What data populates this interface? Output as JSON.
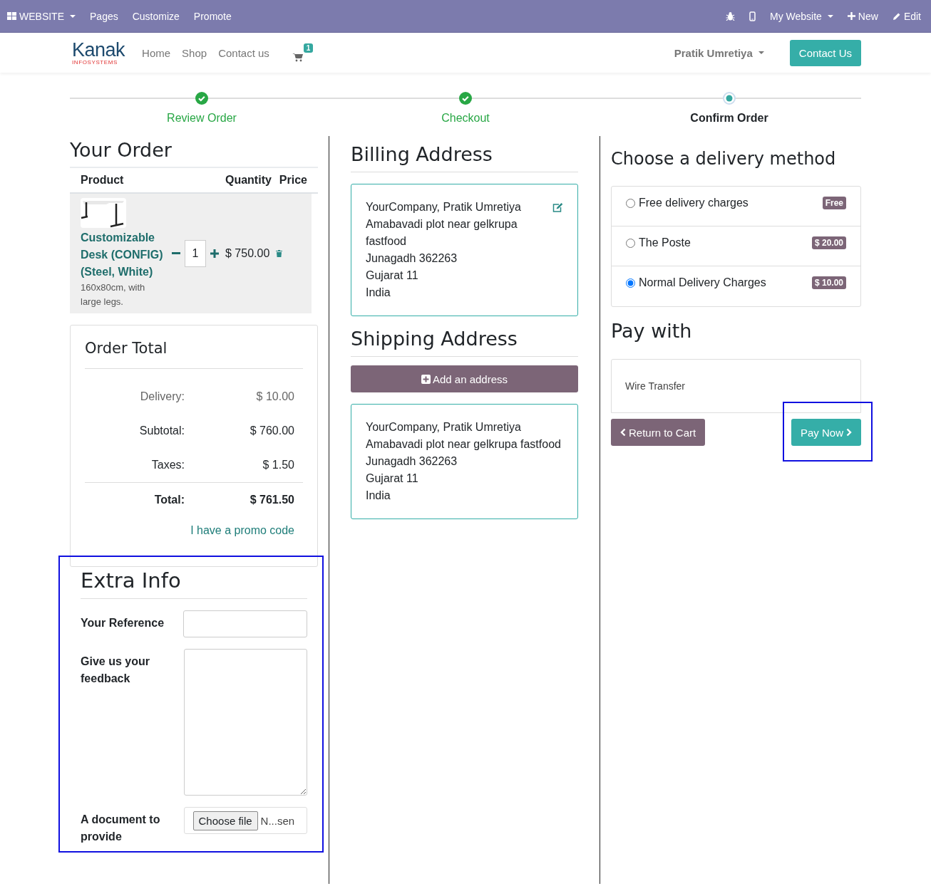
{
  "admin_bar": {
    "app_menu": "WEBSITE",
    "menu": [
      "Pages",
      "Customize",
      "Promote"
    ],
    "site": "My Website",
    "new": "New",
    "edit": "Edit"
  },
  "header": {
    "logo": {
      "name": "Kanak",
      "sub": "INFOSYSTEMS"
    },
    "nav": [
      "Home",
      "Shop",
      "Contact us"
    ],
    "cart_count": "1",
    "user": "Pratik Umretiya",
    "contact_button": "Contact Us"
  },
  "steps": [
    {
      "label": "Review Order",
      "done": true,
      "selected": false
    },
    {
      "label": "Checkout",
      "done": true,
      "selected": false
    },
    {
      "label": "Confirm Order",
      "done": false,
      "selected": true
    }
  ],
  "order": {
    "title": "Your Order",
    "columns": [
      "Product",
      "Quantity",
      "Price"
    ],
    "lines": [
      {
        "name": "Customizable Desk (CONFIG) (Steel, White)",
        "description": "160x80cm, with large legs.",
        "quantity": "1",
        "price": "$ 750.00"
      }
    ]
  },
  "order_total": {
    "title": "Order Total",
    "rows": [
      {
        "label": "Delivery:",
        "value": "$ 10.00",
        "kind": "muted"
      },
      {
        "label": "Subtotal:",
        "value": "$ 760.00",
        "kind": "normal"
      },
      {
        "label": "Taxes:",
        "value": "$ 1.50",
        "kind": "normal"
      },
      {
        "label": "Total:",
        "value": "$ 761.50",
        "kind": "total"
      }
    ],
    "promo_link": "I have a promo code"
  },
  "extra_info": {
    "title": "Extra Info",
    "reference_label": "Your Reference",
    "feedback_label": "Give us your feedback",
    "document_label": "A document to provide",
    "file_button": "Choose file",
    "file_value": "N...sen"
  },
  "billing": {
    "title": "Billing Address",
    "lines": [
      "YourCompany, Pratik Umretiya",
      "Amabavadi plot near gelkrupa fastfood",
      "Junagadh 362263",
      "Gujarat 11",
      "India"
    ]
  },
  "shipping": {
    "title": "Shipping Address",
    "add_button": "Add an address",
    "lines": [
      "YourCompany, Pratik Umretiya",
      "Amabavadi plot near gelkrupa fastfood",
      "Junagadh 362263",
      "Gujarat 11",
      "India"
    ]
  },
  "delivery": {
    "title": "Choose a delivery method",
    "options": [
      {
        "label": "Free delivery charges",
        "price": "Free",
        "selected": false
      },
      {
        "label": "The Poste",
        "price": "$ 20.00",
        "selected": false
      },
      {
        "label": "Normal Delivery Charges",
        "price": "$ 10.00",
        "selected": true
      }
    ]
  },
  "payment": {
    "title": "Pay with",
    "methods": [
      "Wire Transfer"
    ],
    "return_button": "Return to Cart",
    "pay_button": "Pay Now"
  }
}
